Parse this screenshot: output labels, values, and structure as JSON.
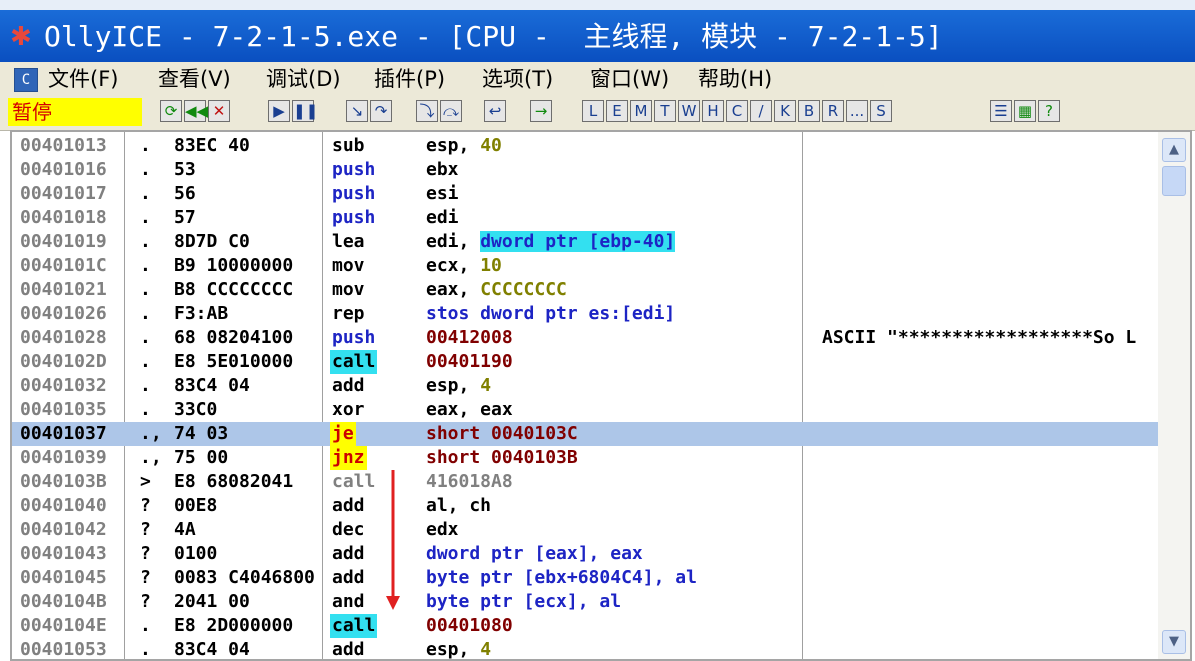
{
  "titlebar": {
    "title": "OllyICE - 7-2-1-5.exe - [CPU -  主线程, 模块 - 7-2-1-5]"
  },
  "menu": {
    "items": [
      "文件(F)",
      "查看(V)",
      "调试(D)",
      "插件(P)",
      "选项(T)",
      "窗口(W)",
      "帮助(H)"
    ]
  },
  "toolbar": {
    "status": "暂停",
    "letter_buttons": [
      "L",
      "E",
      "M",
      "T",
      "W",
      "H",
      "C",
      "/",
      "K",
      "B",
      "R",
      "...",
      "S"
    ],
    "icon_buttons": [
      "restart",
      "rewind",
      "close",
      "run",
      "pause",
      "step-into",
      "step-over",
      "trace-into",
      "trace-over",
      "execute-till-return",
      "go-to"
    ],
    "right_buttons": [
      "list",
      "colors",
      "help"
    ]
  },
  "colors": {
    "selected_row": "#adc6e8",
    "call_highlight": "#33e0f0",
    "jump_highlight": "#ffff00",
    "immediate": "#808000",
    "address": "#800000"
  },
  "disassembly": [
    {
      "addr": "00401013",
      "flag": ".",
      "hex": "83EC 40",
      "mnem": "sub",
      "mnem_style": "",
      "op": "esp, 40",
      "comment": ""
    },
    {
      "addr": "00401016",
      "flag": ".",
      "hex": "53",
      "mnem": "push",
      "mnem_style": "blue",
      "op": "ebx",
      "comment": ""
    },
    {
      "addr": "00401017",
      "flag": ".",
      "hex": "56",
      "mnem": "push",
      "mnem_style": "blue",
      "op": "esi",
      "comment": ""
    },
    {
      "addr": "00401018",
      "flag": ".",
      "hex": "57",
      "mnem": "push",
      "mnem_style": "blue",
      "op": "edi",
      "comment": ""
    },
    {
      "addr": "00401019",
      "flag": ".",
      "hex": "8D7D C0",
      "mnem": "lea",
      "mnem_style": "",
      "op": "edi, dword ptr [ebp-40]",
      "comment": ""
    },
    {
      "addr": "0040101C",
      "flag": ".",
      "hex": "B9 10000000",
      "mnem": "mov",
      "mnem_style": "",
      "op": "ecx, 10",
      "comment": ""
    },
    {
      "addr": "00401021",
      "flag": ".",
      "hex": "B8 CCCCCCCC",
      "mnem": "mov",
      "mnem_style": "",
      "op": "eax, CCCCCCCC",
      "comment": ""
    },
    {
      "addr": "00401026",
      "flag": ".",
      "hex": "F3:AB",
      "mnem": "rep",
      "mnem_style": "",
      "op": "stos dword ptr es:[edi]",
      "comment": ""
    },
    {
      "addr": "00401028",
      "flag": ".",
      "hex": "68 08204100",
      "mnem": "push",
      "mnem_style": "blue",
      "op": "00412008",
      "comment": "ASCII \"******************So L"
    },
    {
      "addr": "0040102D",
      "flag": ".",
      "hex": "E8 5E010000",
      "mnem": "call",
      "mnem_style": "call",
      "op": "00401190",
      "comment": ""
    },
    {
      "addr": "00401032",
      "flag": ".",
      "hex": "83C4 04",
      "mnem": "add",
      "mnem_style": "",
      "op": "esp, 4",
      "comment": ""
    },
    {
      "addr": "00401035",
      "flag": ".",
      "hex": "33C0",
      "mnem": "xor",
      "mnem_style": "",
      "op": "eax, eax",
      "comment": ""
    },
    {
      "addr": "00401037",
      "flag": ".,",
      "hex": "74 03",
      "mnem": "je",
      "mnem_style": "jump",
      "op": "short 0040103C",
      "comment": "",
      "selected": true
    },
    {
      "addr": "00401039",
      "flag": ".,",
      "hex": "75 00",
      "mnem": "jnz",
      "mnem_style": "jump",
      "op": "short 0040103B",
      "comment": ""
    },
    {
      "addr": "0040103B",
      "flag": ">",
      "hex": "E8 68082041",
      "mnem": "call",
      "mnem_style": "gray",
      "op": "416018A8",
      "comment": ""
    },
    {
      "addr": "00401040",
      "flag": "?",
      "hex": "00E8",
      "mnem": "add",
      "mnem_style": "",
      "op": "al, ch",
      "comment": ""
    },
    {
      "addr": "00401042",
      "flag": "?",
      "hex": "4A",
      "mnem": "dec",
      "mnem_style": "",
      "op": "edx",
      "comment": ""
    },
    {
      "addr": "00401043",
      "flag": "?",
      "hex": "0100",
      "mnem": "add",
      "mnem_style": "",
      "op": "dword ptr [eax], eax",
      "comment": ""
    },
    {
      "addr": "00401045",
      "flag": "?",
      "hex": "0083 C4046800",
      "mnem": "add",
      "mnem_style": "",
      "op": "byte ptr [ebx+6804C4], al",
      "comment": ""
    },
    {
      "addr": "0040104B",
      "flag": "?",
      "hex": "2041 00",
      "mnem": "and",
      "mnem_style": "",
      "op": "byte ptr [ecx], al",
      "comment": ""
    },
    {
      "addr": "0040104E",
      "flag": ".",
      "hex": "E8 2D000000",
      "mnem": "call",
      "mnem_style": "call",
      "op": "00401080",
      "comment": ""
    },
    {
      "addr": "00401053",
      "flag": ".",
      "hex": "83C4 04",
      "mnem": "add",
      "mnem_style": "",
      "op": "esp, 4",
      "comment": ""
    }
  ],
  "scrollbar": {
    "up_icon": "chevron-up-icon",
    "down_icon": "chevron-down-icon"
  }
}
